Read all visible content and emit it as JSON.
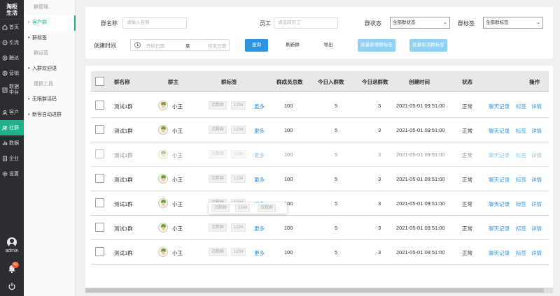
{
  "app": {
    "title_line1": "淘柜",
    "title_line2": "生活"
  },
  "nav": {
    "items": [
      {
        "label": "首页",
        "icon": "home-icon"
      },
      {
        "label": "引流",
        "icon": "funnel-icon"
      },
      {
        "label": "触达",
        "icon": "target-icon"
      },
      {
        "label": "营销",
        "icon": "marketing-icon"
      },
      {
        "label": "数据",
        "label2": "中台",
        "icon": "data-center-icon"
      },
      {
        "label": "客户",
        "icon": "customer-icon"
      },
      {
        "label": "社群",
        "icon": "community-icon",
        "active": true
      },
      {
        "label": "数据",
        "icon": "data-icon"
      },
      {
        "label": "企业",
        "icon": "enterprise-icon"
      },
      {
        "label": "设置",
        "icon": "settings-icon"
      }
    ],
    "user": "admin",
    "notification_count": "50"
  },
  "subnav": {
    "group1": "群管理",
    "item_customer_group": "客户群",
    "item_group_tag": "群标签",
    "group2": "群运营",
    "item_welcome": "入群欢迎语",
    "group3": "建群工具",
    "item_unlimited_qr": "无限群活码",
    "item_auto_invite": "新客自动进群"
  },
  "filter": {
    "group_name_label": "群名称",
    "group_name_placeholder": "请输入名称",
    "staff_label": "员工",
    "staff_placeholder": "请选择员工",
    "status_label": "群状态",
    "status_value": "全部群状态",
    "tag_label": "群标签",
    "tag_value": "全部群标签",
    "created_label": "创建时间",
    "start_placeholder": "开始日期",
    "to": "至",
    "end_placeholder": "结束日期",
    "btn_search": "查询",
    "btn_refresh": "刷新群",
    "btn_export": "导出",
    "btn_batch_add_tag": "批量新增群标签",
    "btn_batch_remove_tag": "批量取消群标签"
  },
  "table": {
    "headers": {
      "name": "群名称",
      "owner": "群主",
      "tags": "群标签",
      "members": "群成员总数",
      "joined": "今日入群数",
      "left": "今日退群数",
      "created": "创建时间",
      "status": "状态",
      "actions": "操作"
    },
    "rows": [
      {
        "name": "测试1群",
        "owner": "小王",
        "tag1": "沉默群",
        "tag2": "1234",
        "more": "更多",
        "members": "100",
        "joined": "5",
        "left": "3",
        "created": "2021-05-01 09:51:00",
        "status": "正常",
        "chat": "聊天记录",
        "tag": "标签",
        "detail": "详情"
      },
      {
        "name": "测试1群",
        "owner": "小王",
        "tag1": "沉默群",
        "tag2": "1234",
        "more": "更多",
        "members": "100",
        "joined": "5",
        "left": "3",
        "created": "2021-05-01 09:51:00",
        "status": "正常",
        "chat": "聊天记录",
        "tag": "标签",
        "detail": "详情"
      },
      {
        "name": "测试1群",
        "owner": "小王",
        "tag1": "沉默群",
        "tag2": "1234",
        "more": "更多",
        "members": "100",
        "joined": "5",
        "left": "3",
        "created": "2021-05-01 09:51:00",
        "status": "正常",
        "chat": "聊天记录",
        "tag": "标签",
        "detail": "详情"
      },
      {
        "name": "测试1群",
        "owner": "小王",
        "tag1": "沉默群",
        "tag2": "1234",
        "more": "更多",
        "members": "100",
        "joined": "5",
        "left": "3",
        "created": "2021-05-01 09:51:00",
        "status": "正常",
        "chat": "聊天记录",
        "tag": "标签",
        "detail": "详情"
      },
      {
        "name": "测试1群",
        "owner": "小王",
        "tag1": "沉默群",
        "tag2": "1234",
        "more": "更多",
        "members": "100",
        "joined": "5",
        "left": "3",
        "created": "2021-05-01 09:51:00",
        "status": "正常",
        "chat": "聊天记录",
        "tag": "标签",
        "detail": "详情"
      },
      {
        "name": "测试1群",
        "owner": "小王",
        "tag1": "沉默群",
        "tag2": "1234",
        "more": "更多",
        "members": "100",
        "joined": "5",
        "left": "3",
        "created": "2021-05-01 09:51:00",
        "status": "正常",
        "chat": "聊天记录",
        "tag": "标签",
        "detail": "详情"
      },
      {
        "name": "测试1群",
        "owner": "小王",
        "tag1": "沉默群",
        "tag2": "1234",
        "more": "更多",
        "members": "100",
        "joined": "5",
        "left": "3",
        "created": "2021-05-01 09:51:00",
        "status": "正常",
        "chat": "聊天记录",
        "tag": "标签",
        "detail": "详情"
      }
    ],
    "popup": {
      "tag1": "沉默群",
      "tag2": "1234",
      "tag3": "沉默群"
    }
  },
  "colors": {
    "accent": "#1fb28a",
    "primary": "#2e94de",
    "nav_bg": "#2b2d31"
  }
}
